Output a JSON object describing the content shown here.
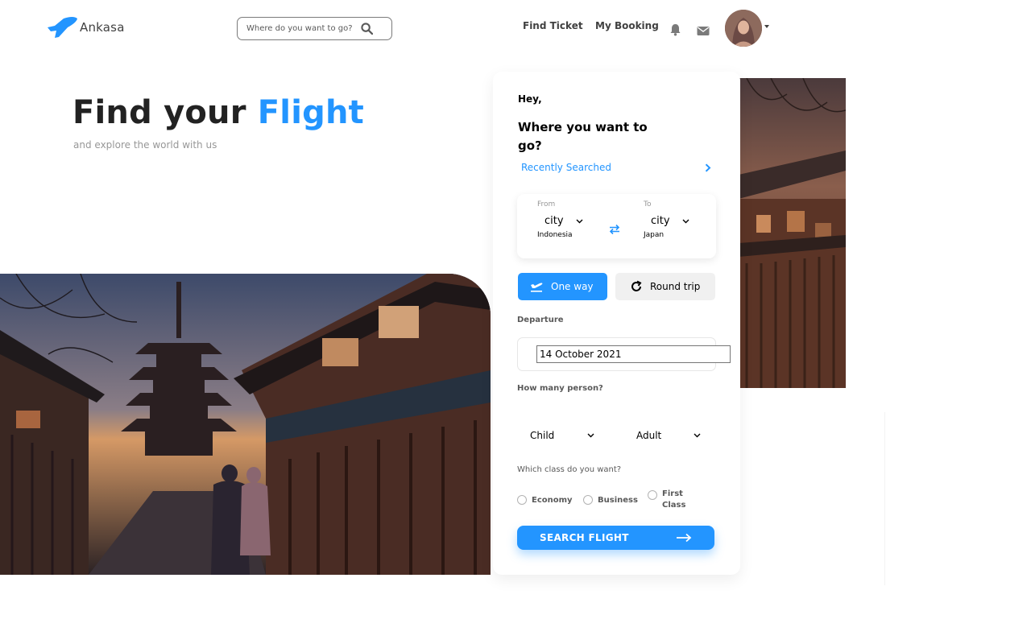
{
  "header": {
    "brand_name": "Ankasa",
    "search_placeholder": "Where do you want to go?",
    "nav": [
      "Find Ticket",
      "My Booking"
    ],
    "icons": [
      "plane-logo-icon",
      "search-icon",
      "bell-icon",
      "mail-icon",
      "avatar",
      "caret-down-icon"
    ]
  },
  "hero": {
    "title_main": "Find your",
    "title_accent": "Flight",
    "subtitle": "and explore the world with us"
  },
  "booking": {
    "greeting": "Hey,",
    "question": "Where you want to go?",
    "recent_label": "Recently Searched",
    "from_label": "From",
    "from_city": "city",
    "from_country": "Indonesia",
    "to_label": "To",
    "to_city": "city",
    "to_country": "Japan",
    "trip_one_way": "One way",
    "trip_round": "Round trip",
    "departure_label": "Departure",
    "departure_value": "14 October 2021",
    "person_label": "How many person?",
    "child_label": "Child",
    "adult_label": "Adult",
    "class_label": "Which class do you want?",
    "class_options": [
      "Economy",
      "Business",
      "First Class"
    ],
    "search_button": "SEARCH FLIGHT"
  },
  "colors": {
    "accent": "#2395ff",
    "text_dark": "#222222",
    "text_muted": "#979797"
  }
}
